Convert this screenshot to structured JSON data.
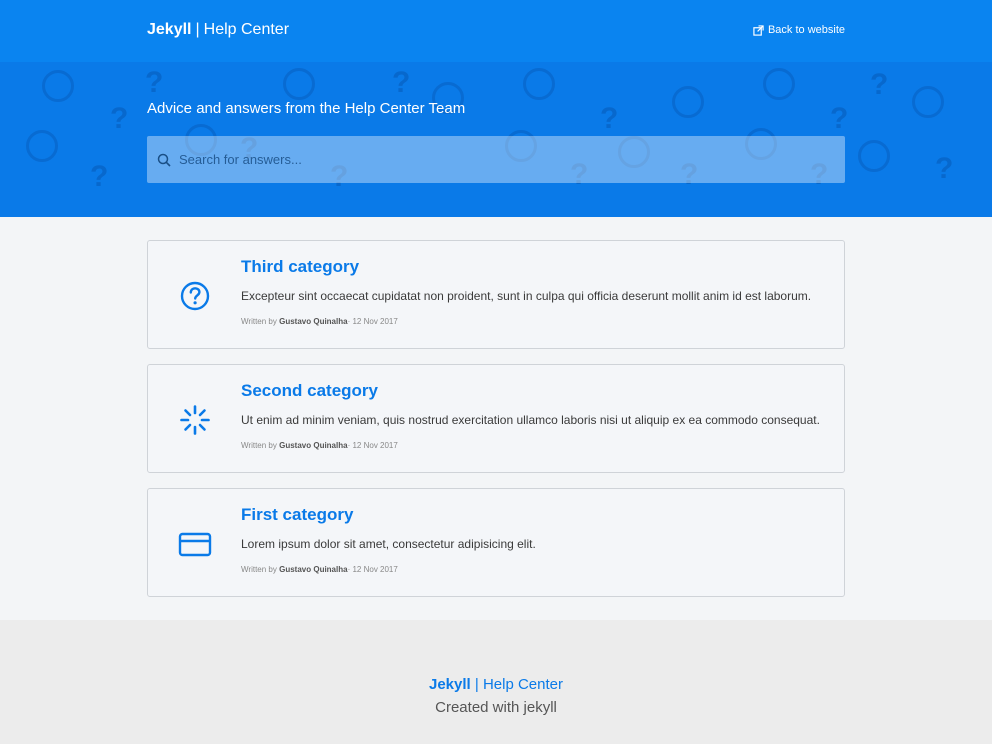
{
  "header": {
    "brand_bold": "Jekyll",
    "brand_separator": "|",
    "brand_rest": "Help Center",
    "back_link": "Back to website"
  },
  "hero": {
    "tagline": "Advice and answers from the Help Center Team",
    "search_placeholder": "Search for answers..."
  },
  "categories": [
    {
      "title": "Third category",
      "description": "Excepteur sint occaecat cupidatat non proident, sunt in culpa qui officia deserunt mollit anim id est laborum.",
      "written_by": "Written by",
      "author": "Gustavo Quinalha",
      "date": "· 12 Nov 2017",
      "icon": "question-circle-icon"
    },
    {
      "title": "Second category",
      "description": "Ut enim ad minim veniam, quis nostrud exercitation ullamco laboris nisi ut aliquip ex ea commodo consequat.",
      "written_by": "Written by",
      "author": "Gustavo Quinalha",
      "date": "· 12 Nov 2017",
      "icon": "spinner-icon"
    },
    {
      "title": "First category",
      "description": "Lorem ipsum dolor sit amet, consectetur adipisicing elit.",
      "written_by": "Written by",
      "author": "Gustavo Quinalha",
      "date": "· 12 Nov 2017",
      "icon": "credit-card-icon"
    }
  ],
  "footer": {
    "brand_bold": "Jekyll",
    "brand_separator": "|",
    "brand_rest": "Help Center",
    "credit": "Created with jekyll"
  },
  "colors": {
    "primary": "#0a84f0",
    "hero": "#0a7ae8",
    "background": "#f3f5f7",
    "footer": "#ececec"
  }
}
